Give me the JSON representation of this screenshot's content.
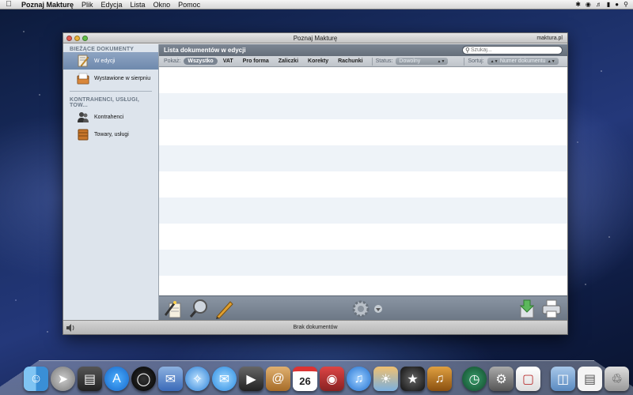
{
  "menubar": {
    "app_name": "Poznaj Makturę",
    "menus": [
      "Plik",
      "Edycja",
      "Lista",
      "Okno",
      "Pomoc"
    ],
    "status_icons": [
      "bluetooth-icon",
      "wifi-icon",
      "volume-icon",
      "battery-icon",
      "user-icon",
      "spotlight-icon"
    ]
  },
  "window": {
    "title": "Poznaj Makturę",
    "right_label": "maktura.pl"
  },
  "sidebar": {
    "section1": "BIEŻĄCE DOKUMENTY",
    "items1": [
      {
        "label": "W edycji",
        "icon": "document-edit-icon"
      },
      {
        "label": "Wystawione w sierpniu",
        "icon": "outbox-tray-icon"
      }
    ],
    "section2": "KONTRAHENCI, USŁUGI, TOW...",
    "items2": [
      {
        "label": "Kontrahenci",
        "icon": "contacts-icon"
      },
      {
        "label": "Towary, usługi",
        "icon": "box-icon"
      }
    ]
  },
  "main": {
    "header_title": "Lista dokumentów w edycji",
    "search_placeholder": "Szukaj...",
    "filters": {
      "show_label": "Pokaż:",
      "options": [
        "Wszystko",
        "VAT",
        "Pro forma",
        "Zaliczki",
        "Korekty",
        "Rachunki"
      ],
      "active": "Wszystko",
      "status_label": "Status:",
      "status_value": "Dowolny",
      "sort_label": "Sortuj:",
      "sort_value": "Numer dokumentu"
    },
    "row_count": 9
  },
  "toolbar": {
    "left_icons": [
      "new-document-icon",
      "preview-icon",
      "edit-pencil-icon"
    ],
    "center_icon": "gear-icon",
    "right_icons": [
      "export-pdf-icon",
      "print-icon"
    ]
  },
  "status": {
    "text": "Brak dokumentów"
  },
  "dock": {
    "apps": [
      "finder-icon",
      "launchpad-icon",
      "dashboard-icon",
      "app-store-icon",
      "safari-speed-icon",
      "mail-stamp-icon",
      "safari-icon",
      "messages-icon",
      "facetime-icon",
      "address-book-icon",
      "calendar-icon",
      "photo-booth-icon",
      "itunes-icon",
      "iphoto-icon",
      "imovie-icon",
      "garageband-icon",
      "time-machine-icon",
      "system-preferences-icon",
      "preview-icon",
      "folder-icon",
      "document-icon",
      "trash-icon"
    ],
    "calendar_day": "26"
  }
}
